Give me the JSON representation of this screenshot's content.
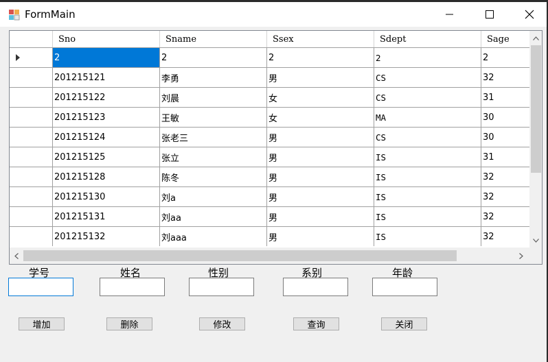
{
  "window": {
    "title": "FormMain"
  },
  "grid": {
    "columns": [
      "Sno",
      "Sname",
      "Ssex",
      "Sdept",
      "Sage"
    ],
    "rows": [
      {
        "sno": "2",
        "sname": "2",
        "ssex": "2",
        "sdept": "2",
        "sage": "2"
      },
      {
        "sno": "201215121",
        "sname": "李勇",
        "ssex": "男",
        "sdept": "CS",
        "sage": "32"
      },
      {
        "sno": "201215122",
        "sname": "刘晨",
        "ssex": "女",
        "sdept": "CS",
        "sage": "31"
      },
      {
        "sno": "201215123",
        "sname": "王敏",
        "ssex": "女",
        "sdept": "MA",
        "sage": "30"
      },
      {
        "sno": "201215124",
        "sname": "张老三",
        "ssex": "男",
        "sdept": "CS",
        "sage": "30"
      },
      {
        "sno": "201215125",
        "sname": "张立",
        "ssex": "男",
        "sdept": "IS",
        "sage": "31"
      },
      {
        "sno": "201215128",
        "sname": "陈冬",
        "ssex": "男",
        "sdept": "IS",
        "sage": "32"
      },
      {
        "sno": "201215130",
        "sname": "刘a",
        "ssex": "男",
        "sdept": "IS",
        "sage": "32"
      },
      {
        "sno": "201215131",
        "sname": "刘aa",
        "ssex": "男",
        "sdept": "IS",
        "sage": "32"
      },
      {
        "sno": "201215132",
        "sname": "刘aaa",
        "ssex": "男",
        "sdept": "IS",
        "sage": "32"
      }
    ]
  },
  "form": {
    "labels": {
      "sno": "学号",
      "sname": "姓名",
      "ssex": "性别",
      "sdept": "系别",
      "sage": "年龄"
    },
    "values": {
      "sno": "",
      "sname": "",
      "ssex": "",
      "sdept": "",
      "sage": ""
    }
  },
  "buttons": {
    "add": "增加",
    "delete": "删除",
    "modify": "修改",
    "query": "查询",
    "close": "关闭"
  },
  "colors": {
    "selection": "#0078d7",
    "window_bg": "#f0f0f0"
  }
}
